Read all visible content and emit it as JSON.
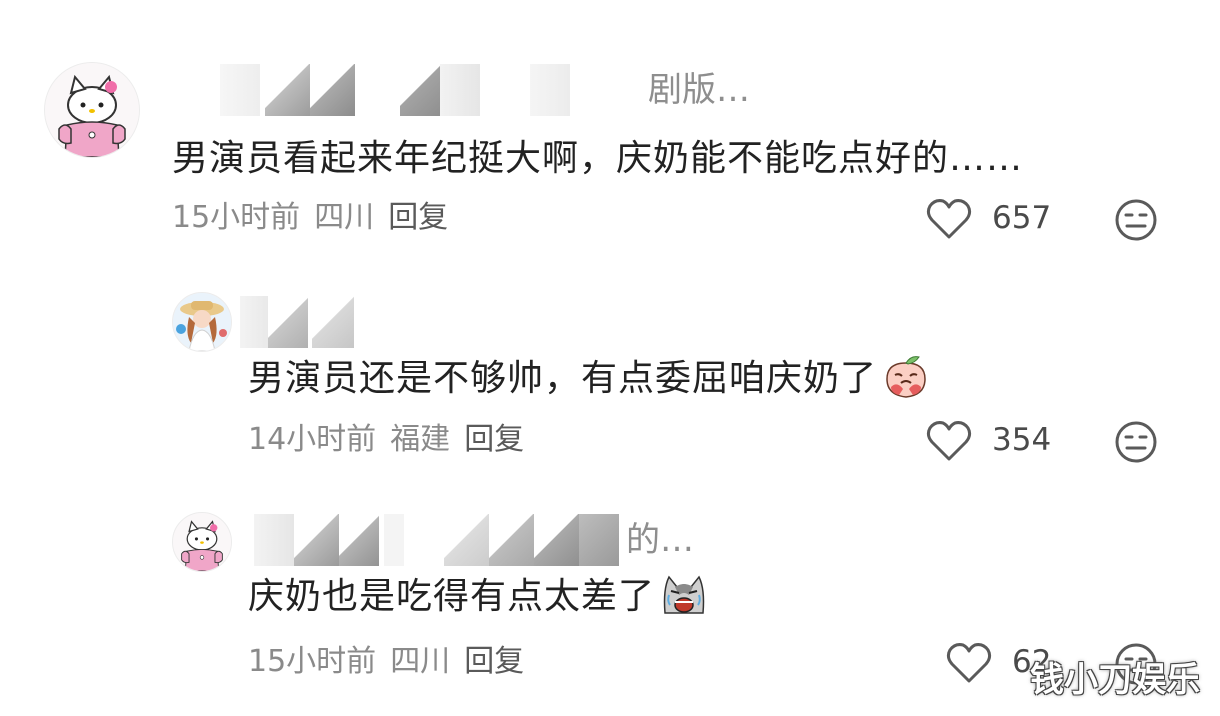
{
  "comments": [
    {
      "username_tail": "剧版…",
      "text": "男演员看起来年纪挺大啊，庆奶能不能吃点好的……",
      "time": "15小时前",
      "location": "四川",
      "reply_label": "回复",
      "likes": "657",
      "avatar": "hello-kitty-avatar"
    },
    {
      "username_tail": "",
      "text": "男演员还是不够帅，有点委屈咱庆奶了",
      "emoji": "peach-crying-emoji",
      "time": "14小时前",
      "location": "福建",
      "reply_label": "回复",
      "likes": "354",
      "avatar": "girl-with-hat-avatar"
    },
    {
      "username_tail": "的…",
      "text": "庆奶也是吃得有点太差了",
      "emoji": "cat-crying-emoji",
      "time": "15小时前",
      "location": "四川",
      "reply_label": "回复",
      "likes": "62",
      "avatar": "hello-kitty-avatar"
    }
  ],
  "watermark": "钱小刀娱乐",
  "colors": {
    "text": "#222222",
    "meta": "#8a8a8a",
    "avatar_pink": "#f0a6c8"
  }
}
